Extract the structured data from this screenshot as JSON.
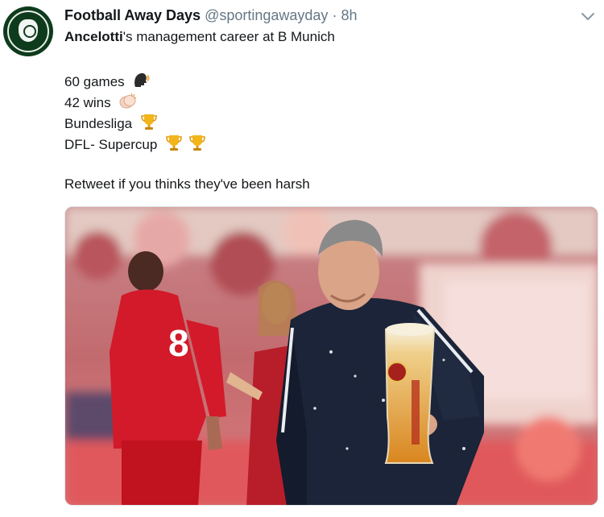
{
  "tweet": {
    "display_name": "Football Away Days",
    "handle": "@sportingawayday",
    "separator": "·",
    "time": "8h",
    "headline_bold": "Ancelotti",
    "headline_rest": "'s management career at B Munich",
    "stats": [
      {
        "text": "60 games",
        "icon": "speaking-head-icon"
      },
      {
        "text": "42 wins",
        "icon": "clapping-hands-icon"
      },
      {
        "text": "Bundesliga",
        "icon": "trophy-icon"
      },
      {
        "text": "DFL- Supercup",
        "icon": "trophy-icon"
      }
    ],
    "cta": "Retweet if you thinks they've been harsh",
    "menu_icon": "chevron-down-icon"
  },
  "colors": {
    "name": "#14171a",
    "meta": "#657786",
    "trophy": "#f2b51a",
    "jersey_red": "#d21a2a",
    "jacket_navy": "#1b2438"
  },
  "media": {
    "jersey_number": "8"
  }
}
